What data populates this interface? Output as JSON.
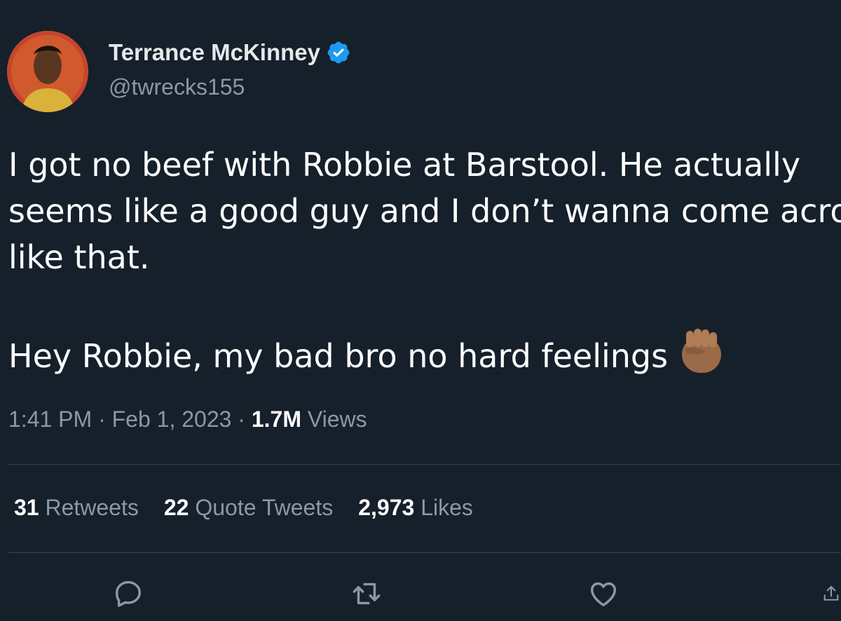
{
  "author": {
    "name": "Terrance McKinney",
    "handle": "@twrecks155",
    "verified": true
  },
  "tweet": {
    "lines": [
      "I got no beef with Robbie at Barstool. He actually",
      "seems like a good guy and I don’t wanna come across",
      "like that."
    ],
    "second_paragraph": "Hey Robbie, my bad bro no hard feelings",
    "emoji": "raised-fist-medium-dark-skin"
  },
  "meta": {
    "time": "1:41 PM",
    "date": "Feb 1, 2023",
    "views_count": "1.7M",
    "views_label": "Views"
  },
  "stats": {
    "retweets_count": "31",
    "retweets_label": "Retweets",
    "quotes_count": "22",
    "quotes_label": "Quote Tweets",
    "likes_count": "2,973",
    "likes_label": "Likes"
  },
  "icons": [
    "reply-icon",
    "retweet-icon",
    "like-icon",
    "share-icon"
  ],
  "colors": {
    "background": "#15202b",
    "text": "#ffffff",
    "secondary": "#8b98a5",
    "verified": "#1d9bf0"
  }
}
